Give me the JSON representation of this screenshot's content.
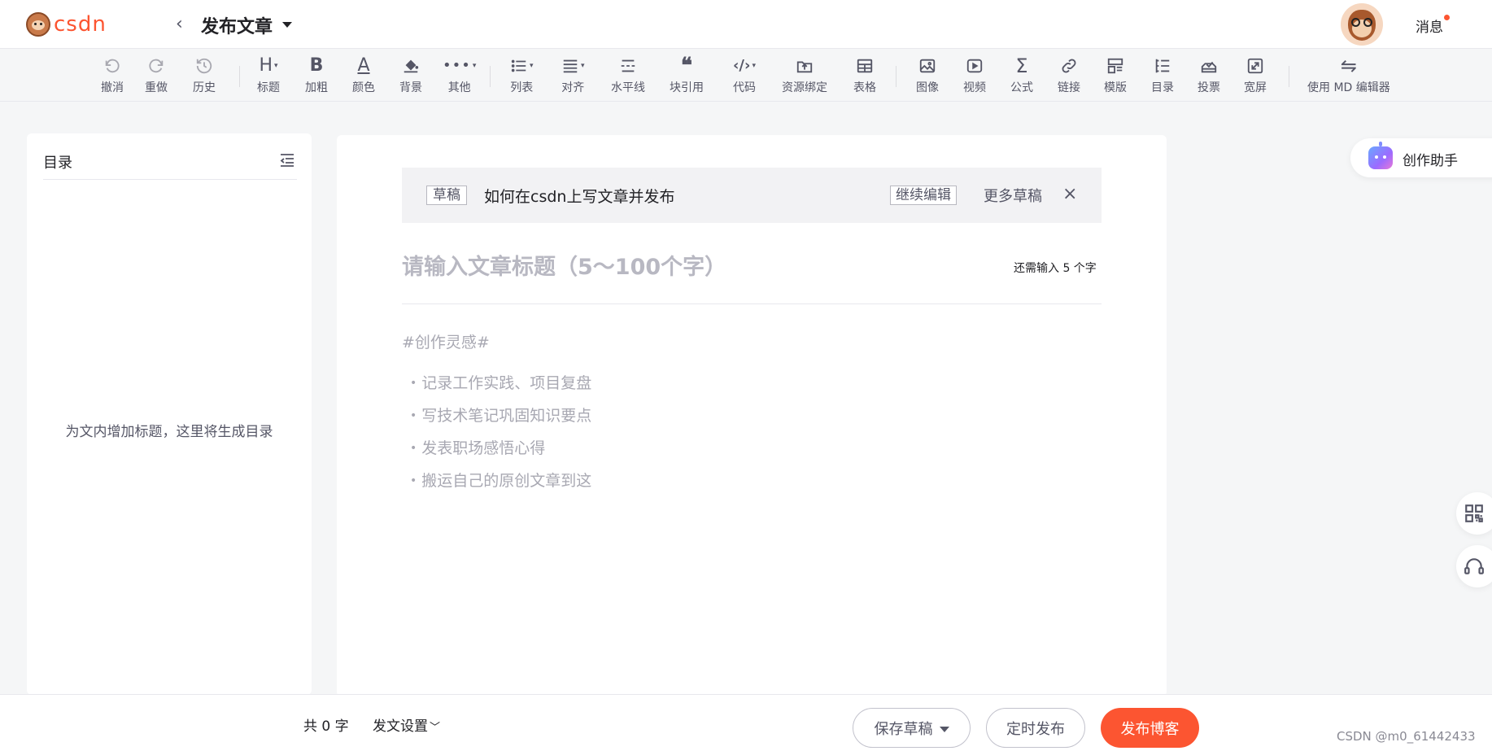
{
  "header": {
    "logo_text": "csdn",
    "title": "发布文章",
    "message_label": "消息",
    "brand_color": "#fc5531"
  },
  "toolbar": {
    "items": [
      {
        "icon": "undo-icon",
        "label": "撤消"
      },
      {
        "icon": "redo-icon",
        "label": "重做"
      },
      {
        "icon": "history-icon",
        "label": "历史"
      },
      {
        "icon": "heading-icon",
        "label": "标题"
      },
      {
        "icon": "bold-icon",
        "label": "加粗"
      },
      {
        "icon": "font-color-icon",
        "label": "颜色"
      },
      {
        "icon": "paint-bucket-icon",
        "label": "背景"
      },
      {
        "icon": "more-dots-icon",
        "label": "其他"
      },
      {
        "icon": "list-icon",
        "label": "列表"
      },
      {
        "icon": "align-icon",
        "label": "对齐"
      },
      {
        "icon": "horizontal-rule-icon",
        "label": "水平线"
      },
      {
        "icon": "quote-icon",
        "label": "块引用"
      },
      {
        "icon": "code-icon",
        "label": "代码"
      },
      {
        "icon": "resource-upload-icon",
        "label": "资源绑定"
      },
      {
        "icon": "table-icon",
        "label": "表格"
      },
      {
        "icon": "image-icon",
        "label": "图像"
      },
      {
        "icon": "video-icon",
        "label": "视频"
      },
      {
        "icon": "sigma-icon",
        "label": "公式"
      },
      {
        "icon": "link-icon",
        "label": "链接"
      },
      {
        "icon": "template-icon",
        "label": "模版"
      },
      {
        "icon": "toc-icon",
        "label": "目录"
      },
      {
        "icon": "vote-icon",
        "label": "投票"
      },
      {
        "icon": "widescreen-icon",
        "label": "宽屏"
      },
      {
        "icon": "switch-arrows-icon",
        "label": "使用 MD 编辑器"
      }
    ]
  },
  "toc": {
    "title": "目录",
    "empty_text": "为文内增加标题，这里将生成目录"
  },
  "draft": {
    "tag": "草稿",
    "title": "如何在csdn上写文章并发布",
    "continue_label": "继续编辑",
    "more_label": "更多草稿",
    "close_symbol": "×"
  },
  "editor": {
    "title_placeholder": "请输入文章标题（5～100个字）",
    "char_hint": "还需输入 5 个字",
    "body_hashtag": "#创作灵感#",
    "body_tips": [
      "记录工作实践、项目复盘",
      "写技术笔记巩固知识要点",
      "发表职场感悟心得",
      "搬运自己的原创文章到这"
    ]
  },
  "side": {
    "assistant_label": "创作助手"
  },
  "footer": {
    "word_count": "共 0 字",
    "settings_label": "发文设置",
    "save_draft_label": "保存草稿",
    "schedule_label": "定时发布",
    "publish_label": "发布博客",
    "watermark": "CSDN @m0_61442433"
  }
}
